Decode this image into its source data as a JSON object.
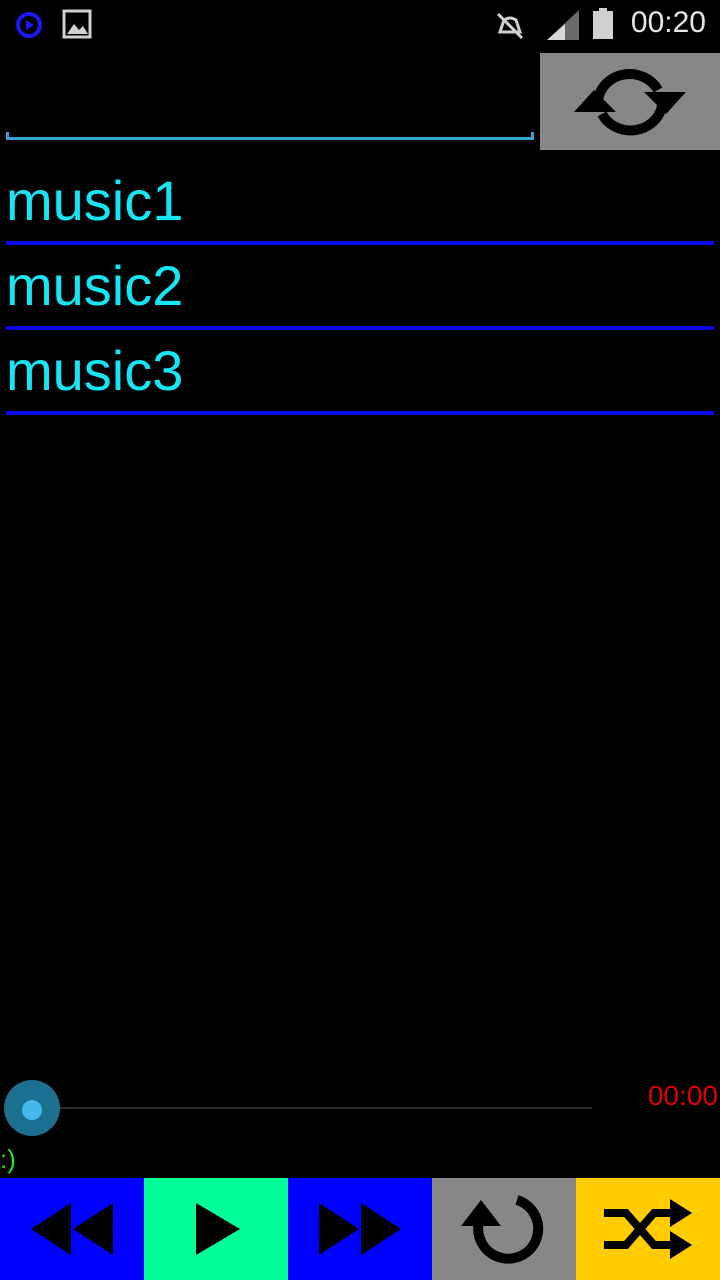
{
  "status_bar": {
    "time": "00:20",
    "icons": [
      "media-player-notification-icon",
      "image-notification-icon",
      "mute-icon",
      "signal-icon",
      "battery-icon"
    ]
  },
  "search": {
    "value": "",
    "placeholder": ""
  },
  "refresh_button": {
    "icon": "refresh-icon"
  },
  "playlist": {
    "items": [
      {
        "title": "music1"
      },
      {
        "title": "music2"
      },
      {
        "title": "music3"
      }
    ]
  },
  "player": {
    "position": 0,
    "time": "00:00",
    "status": ":)"
  },
  "controls": [
    {
      "name": "rewind",
      "icon": "rewind-icon",
      "color": "#0000ff"
    },
    {
      "name": "play",
      "icon": "play-icon",
      "color": "#00ff99"
    },
    {
      "name": "fast-forward",
      "icon": "fast-forward-icon",
      "color": "#0000ff"
    },
    {
      "name": "repeat",
      "icon": "repeat-icon",
      "color": "#878787"
    },
    {
      "name": "shuffle",
      "icon": "shuffle-icon",
      "color": "#ffcc00"
    }
  ],
  "colors": {
    "accent": "#15e6f5",
    "divider": "#0a0ae6",
    "time": "#e00000",
    "status": "#22e022"
  }
}
